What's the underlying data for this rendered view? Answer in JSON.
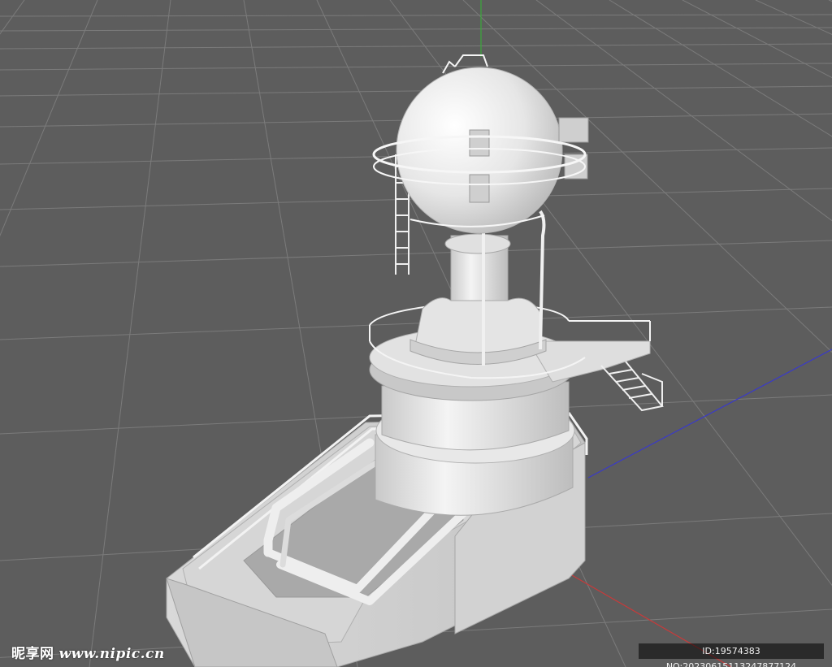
{
  "viewport": {
    "background_color": "#5d5d5d",
    "grid_color": "#7a7a7a",
    "model_color": "#e8e8e8",
    "axis_colors": {
      "x": "#c83a3a",
      "y": "#3aa83a",
      "z": "#3a3ac8"
    }
  },
  "watermark": {
    "brand": "昵享网",
    "site": "www.nipic.cn",
    "id_text": "ID:19574383 NO:20230615113247877124"
  }
}
